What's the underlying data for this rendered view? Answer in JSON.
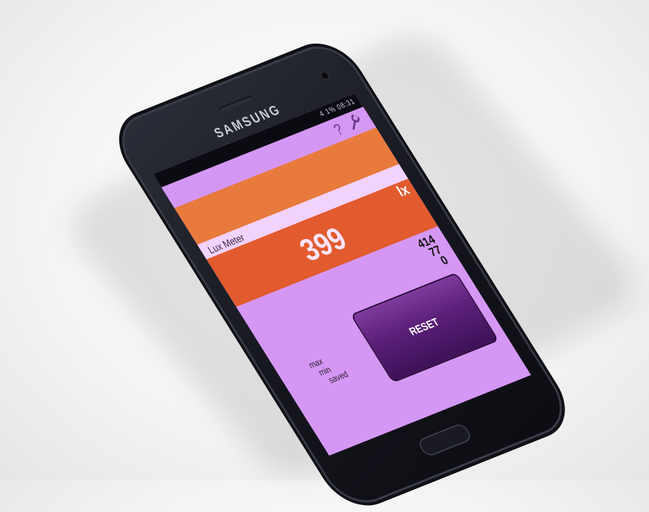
{
  "device": {
    "brand": "SAMSUNG"
  },
  "status_bar": {
    "time": "08:31",
    "battery": "4 1%"
  },
  "action_bar": {
    "help_glyph": "?",
    "help_icon": "question-mark-icon",
    "settings_icon": "wrench-icon"
  },
  "app": {
    "title": "Lux Meter",
    "unit": "lx",
    "reading": "399",
    "stats": {
      "max_label": "max",
      "min_label": "min",
      "saved_label": "saved",
      "max_value": "414",
      "min_value": "77",
      "saved_value": "0"
    },
    "reset_label": "RESET"
  },
  "colors": {
    "screen_bg": "#d597f4",
    "reading_bg": "#e25b2e",
    "reset_button": "#5a1f78"
  }
}
